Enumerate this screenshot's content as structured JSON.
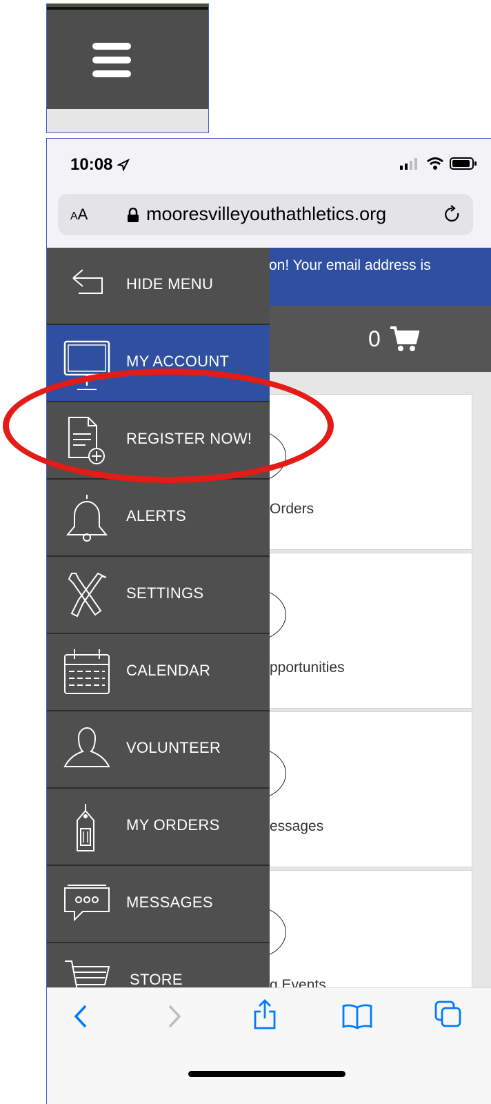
{
  "status_bar": {
    "time": "10:08"
  },
  "address_bar": {
    "text_size_label_small": "A",
    "text_size_label": "A",
    "url": "mooresvilleyouthathletics.org"
  },
  "page": {
    "notice_text": "on! Your email address is",
    "cart_count": "0",
    "cards": [
      {
        "label": "Orders"
      },
      {
        "label": "pportunities"
      },
      {
        "label": "essages"
      },
      {
        "label": "g Events"
      }
    ]
  },
  "side_menu": {
    "items": [
      {
        "label": "HIDE MENU",
        "icon": "back-arrow-icon"
      },
      {
        "label": "MY ACCOUNT",
        "icon": "monitor-icon"
      },
      {
        "label": "REGISTER NOW!",
        "icon": "document-add-icon"
      },
      {
        "label": "ALERTS",
        "icon": "bell-icon"
      },
      {
        "label": "SETTINGS",
        "icon": "tools-icon"
      },
      {
        "label": "CALENDAR",
        "icon": "calendar-icon"
      },
      {
        "label": "VOLUNTEER",
        "icon": "person-icon"
      },
      {
        "label": "MY ORDERS",
        "icon": "tag-icon"
      },
      {
        "label": "MESSAGES",
        "icon": "chat-icon"
      },
      {
        "label": "STORE",
        "icon": "cart-icon"
      }
    ]
  },
  "toolbar": {
    "icons": [
      "back-icon",
      "forward-icon",
      "share-icon",
      "bookmarks-icon",
      "tabs-icon"
    ]
  },
  "colors": {
    "menu_background": "#4f4f4f",
    "active_item": "#2f4fa0",
    "highlight": "#e41b17",
    "ios_blue": "#007aff"
  }
}
